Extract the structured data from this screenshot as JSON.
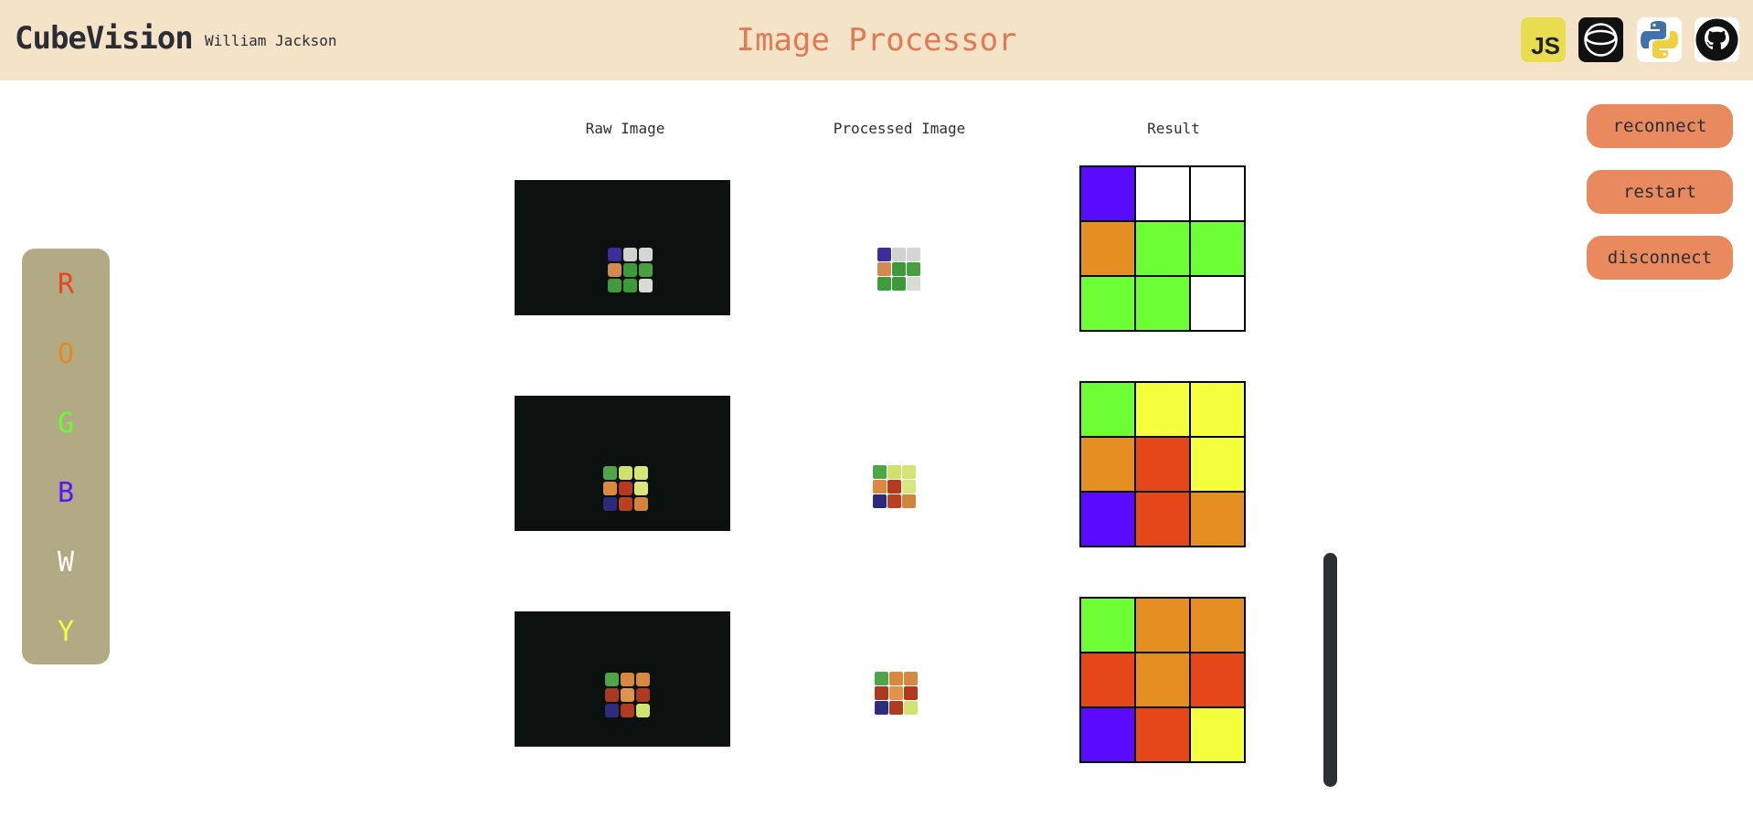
{
  "header": {
    "brand": "CubeVision",
    "author": "William Jackson",
    "title": "Image Processor",
    "icons": [
      "javascript-icon",
      "webgl-ring-icon",
      "python-icon",
      "github-icon"
    ],
    "js_label": "JS"
  },
  "palette": {
    "letters": [
      {
        "label": "R",
        "color": "#e8461c"
      },
      {
        "label": "O",
        "color": "#e8891c"
      },
      {
        "label": "G",
        "color": "#66ff2e"
      },
      {
        "label": "B",
        "color": "#5a12ff"
      },
      {
        "label": "W",
        "color": "#ffffff"
      },
      {
        "label": "Y",
        "color": "#f3ff3d"
      }
    ]
  },
  "columns": {
    "raw": "Raw Image",
    "processed": "Processed Image",
    "result": "Result"
  },
  "buttons": {
    "reconnect": "reconnect",
    "restart": "restart",
    "disconnect": "disconnect"
  },
  "colors": {
    "B": "#5a0bff",
    "W": "#ffffff",
    "O": "#e58e22",
    "G": "#6cff33",
    "Y": "#f5ff3b",
    "R": "#e64718"
  },
  "faces": [
    {
      "result": [
        "B",
        "W",
        "W",
        "O",
        "G",
        "G",
        "G",
        "G",
        "W"
      ],
      "raw": [
        "#3a2f9a",
        "#d0d2d0",
        "#d5d5d5",
        "#d48a4f",
        "#3c9a3a",
        "#4aa040",
        "#3f9c3c",
        "#3d9a39",
        "#d9dbd6"
      ]
    },
    {
      "result": [
        "G",
        "Y",
        "Y",
        "O",
        "R",
        "Y",
        "B",
        "R",
        "O"
      ],
      "raw": [
        "#4fa54a",
        "#cfe06c",
        "#d6e676",
        "#d98a3f",
        "#b53a1e",
        "#d9e67a",
        "#2c2a7a",
        "#b9411f",
        "#d2843a"
      ]
    },
    {
      "result": [
        "G",
        "O",
        "O",
        "R",
        "O",
        "R",
        "B",
        "R",
        "Y"
      ],
      "raw": [
        "#4ea548",
        "#d8893f",
        "#d58a43",
        "#a83a1f",
        "#e0934b",
        "#ae3b1e",
        "#2e2d7d",
        "#b03c1f",
        "#d2e470"
      ]
    }
  ]
}
